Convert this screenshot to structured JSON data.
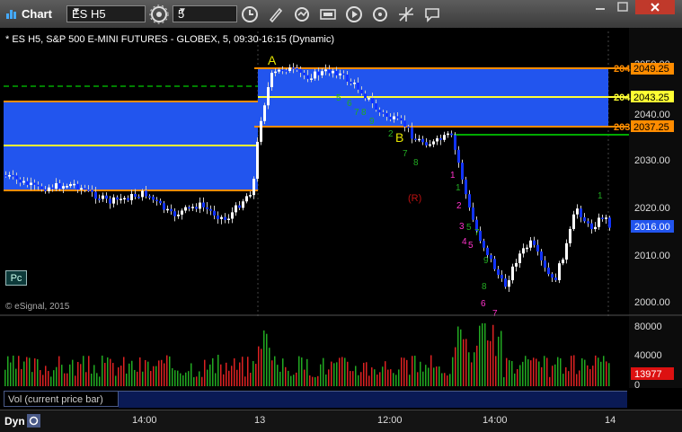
{
  "window": {
    "title": "Chart"
  },
  "toolbar": {
    "symbol": "ES H5",
    "interval": "5",
    "dropdown_glyph": "▼"
  },
  "chart": {
    "header": "* ES H5, S&P 500 E-MINI FUTURES - GLOBEX, 5, 09:30-16:15 (Dynamic)",
    "copyright": "© eSignal, 2015",
    "annotations": {
      "A": "A",
      "B": "B",
      "R": "(R)"
    },
    "price_ticks": [
      "2050.00",
      "2040.00",
      "2030.00",
      "2020.00",
      "2010.00",
      "2000.00"
    ],
    "price_tags": [
      {
        "left": "204",
        "value": "2049.25",
        "color": "#ff8c00"
      },
      {
        "left": "204",
        "value": "2043.25",
        "color": "#ffff00"
      },
      {
        "left": "203",
        "value": "2037.25",
        "color": "#ff8c00"
      }
    ],
    "last_price": "2016.00",
    "pc_label": "Pc"
  },
  "volume": {
    "label": "Vol (current price bar)",
    "ticks": [
      "80000",
      "40000",
      "0"
    ],
    "current": "13977"
  },
  "time_axis": {
    "labels": [
      "14:00",
      "13",
      "12:00",
      "14:00",
      "14"
    ]
  },
  "bottom": {
    "label": "Dyn"
  }
}
